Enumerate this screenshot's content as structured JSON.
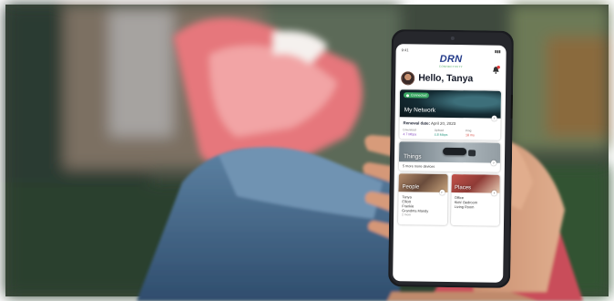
{
  "photo": {
    "description_icon": "phone-in-hand-photo",
    "colors": {
      "sneaker": "#e8787d",
      "jeans": "#466b8e",
      "couch": "#2f4a30",
      "skin": "#d8a282"
    }
  },
  "app": {
    "logo": "DRN",
    "logo_tagline": "CONNECTIVITY",
    "greeting": "Hello, Tanya",
    "network": {
      "badge": "Connected",
      "title": "My Network",
      "renewal_label": "Renewal date:",
      "renewal_value": "April 20, 2023",
      "stats": [
        {
          "label": "Download",
          "value": "4.7 Mbps"
        },
        {
          "label": "Upload",
          "value": "4.8 Mbps"
        },
        {
          "label": "Ping",
          "value": "18 ms"
        }
      ]
    },
    "things": {
      "title": "Things",
      "subtitle": "5 more more devices"
    },
    "people": {
      "title": "People",
      "items": [
        "Tanya",
        "Elliott",
        "Frankie",
        "Grandma Mandy"
      ],
      "more": "2 more"
    },
    "places": {
      "title": "Places",
      "items": [
        "Office",
        "Kids' Bedroom",
        "Living Room"
      ]
    }
  }
}
